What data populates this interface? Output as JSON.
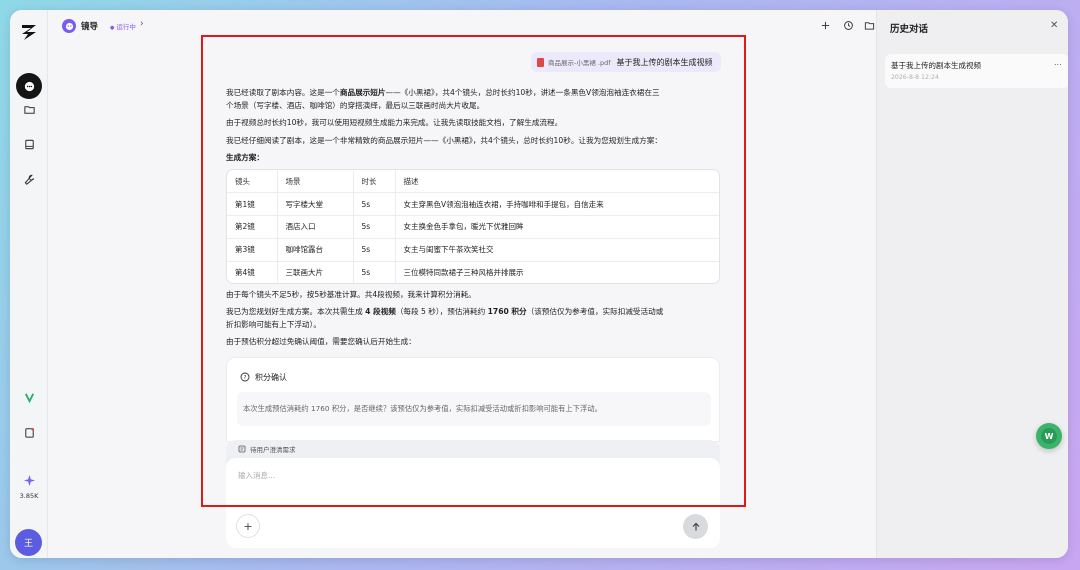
{
  "rail": {
    "credits": "3.85K",
    "avatar_text": "王"
  },
  "header": {
    "agent_name": "镜导",
    "status": "运行中"
  },
  "chat": {
    "attachment_name": "商品展示-小黑裙 .pdf",
    "user_message": "基于我上传的剧本生成视频",
    "p1_pre": "我已经读取了剧本内容。这是一个",
    "p1_bold": "商品展示短片",
    "p1_line1_rest": "——《小黑裙》，共4个镜头，总时长约10秒，讲述一条黑色V领泡泡袖连衣裙在三",
    "p1_line2": "个场景（写字楼、酒店、咖啡馆）的穿搭演绎，最后以三联画时尚大片收尾。",
    "p2": "由于视频总时长约10秒，我可以使用短视频生成能力来完成。让我先读取技能文档，了解生成流程。",
    "p3": "我已经仔细阅读了剧本，这是一个非常精致的商品展示短片——《小黑裙》，共4个镜头，总时长约10秒。让我为您规划生成方案：",
    "plan_heading": "生成方案：",
    "table": {
      "headers": [
        "镜头",
        "场景",
        "时长",
        "描述"
      ],
      "rows": [
        [
          "第1镜",
          "写字楼大堂",
          "5s",
          "女主穿黑色V领泡泡袖连衣裙，手持咖啡和手提包，自信走来"
        ],
        [
          "第2镜",
          "酒店入口",
          "5s",
          "女主换金色手拿包，暖光下优雅回眸"
        ],
        [
          "第3镜",
          "咖啡馆露台",
          "5s",
          "女主与闺蜜下午茶欢笑社交"
        ],
        [
          "第4镜",
          "三联画大片",
          "5s",
          "三位模特同款裙子三种风格并排展示"
        ]
      ]
    },
    "p4": "由于每个镜头不足5秒，按5秒基准计算。共4段视频，我来计算积分消耗。",
    "p5_pre": "我已为您规划好生成方案。本次共需生成 ",
    "p5_bold1": "4 段视频",
    "p5_mid": "（每段 5 秒），预估消耗约 ",
    "p5_bold2": "1760 积分",
    "p5_post": "（该预估仅为参考值，实际扣减受活动或",
    "p5_line2": "折扣影响可能有上下浮动）。",
    "p6": "由于预估积分超过免确认阈值，需要您确认后开始生成：",
    "confirm_title": "积分确认",
    "confirm_body": "本次生成预估消耗约 1760 积分，是否继续？该预估仅为参考值，实际扣减受活动或折扣影响可能有上下浮动。"
  },
  "composer": {
    "pending_label": "待用户澄清需求",
    "placeholder": "输入消息..."
  },
  "history": {
    "title": "历史对话",
    "item_title": "基于我上传的剧本生成视频",
    "item_time": "2026-8-8 12:24",
    "more": "..."
  },
  "float_label": "W"
}
